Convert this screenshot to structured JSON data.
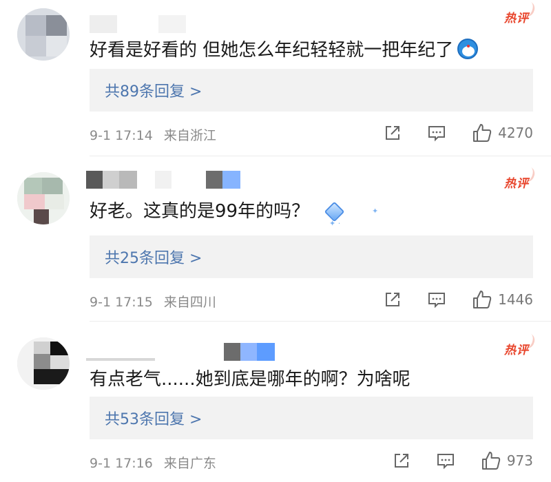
{
  "comments": [
    {
      "text": "好看是好看的 但她怎么年纪轻轻就一把年纪了",
      "emoji_icon": "doraemon-face-icon",
      "hot_label": "热评",
      "replies_label": "共89条回复 >",
      "time": "9-1 17:14",
      "location": "来自浙江",
      "likes": "4270"
    },
    {
      "text": "好老。这真的是99年的吗？",
      "badge_icon": "diamond-badge-icon",
      "hot_label": "热评",
      "replies_label": "共25条回复 >",
      "time": "9-1 17:15",
      "location": "来自四川",
      "likes": "1446"
    },
    {
      "text": "有点老气......她到底是哪年的啊？为啥呢",
      "hot_label": "热评",
      "replies_label": "共53条回复 >",
      "time": "9-1 17:16",
      "location": "来自广东",
      "likes": "973"
    }
  ],
  "colors": {
    "hot": "#e8452c",
    "reply_link": "#4d76ae",
    "reply_bg": "#f2f2f2",
    "meta": "#8a8a8a"
  }
}
